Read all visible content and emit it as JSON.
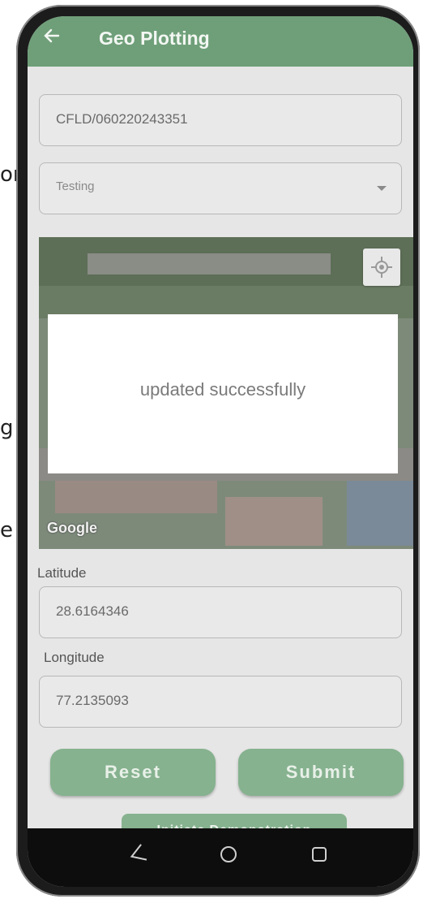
{
  "background_text": [
    "or",
    "g",
    "e"
  ],
  "appbar": {
    "title": "Geo Plotting",
    "back_icon": "arrow-left-icon"
  },
  "form": {
    "id_field_value": "CFLD/060220243351",
    "dropdown_value": "Testing",
    "latitude_label": "Latitude",
    "latitude_value": "28.6164346",
    "longitude_label": "Longitude",
    "longitude_value": "77.2135093"
  },
  "map": {
    "attribution": "Google",
    "locate_icon": "my-location-icon"
  },
  "toast": {
    "message": "updated successfully"
  },
  "buttons": {
    "reset": "Reset",
    "submit": "Submit",
    "initiate": "Initiate Demonstration"
  },
  "navbar": {
    "back": "nav-back-icon",
    "home": "nav-home-icon",
    "recents": "nav-recents-icon"
  },
  "colors": {
    "accent": "#6f9f79",
    "button": "#86b28f",
    "navbar": "#0d0d0d"
  }
}
